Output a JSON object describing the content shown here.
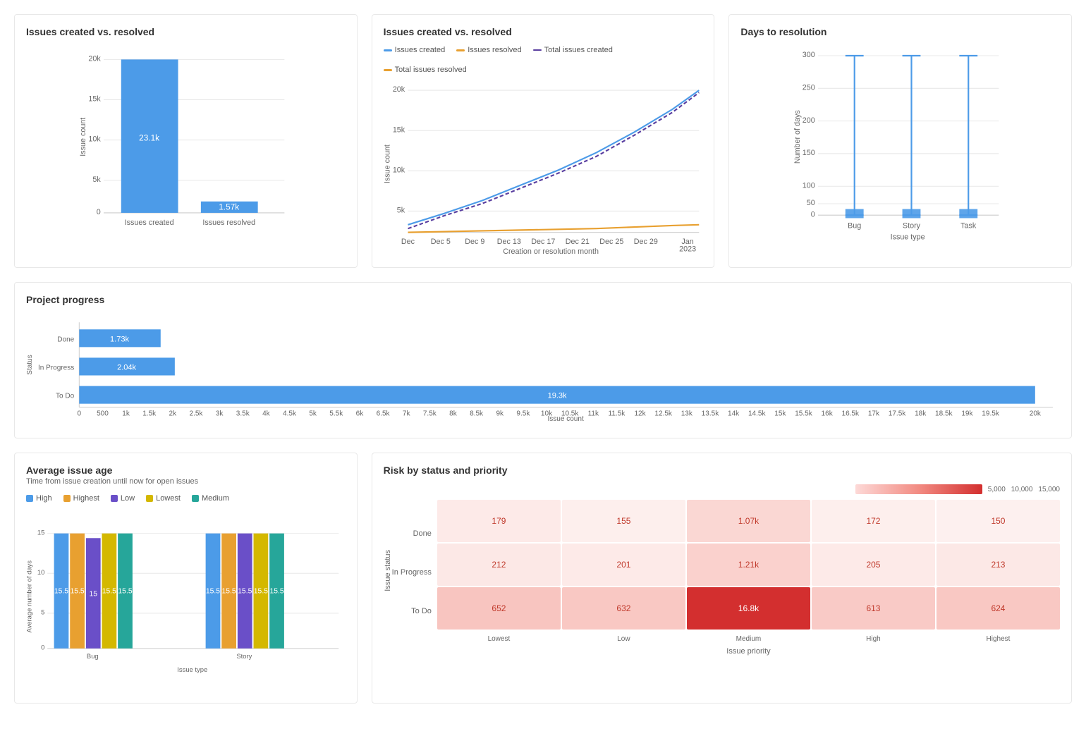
{
  "charts": {
    "bar_compare": {
      "title": "Issues created vs. resolved",
      "bars": [
        {
          "label": "Issues created",
          "value": "23.1k",
          "height_pct": 100
        },
        {
          "label": "Issues resolved",
          "value": "1.57k",
          "height_pct": 7
        }
      ],
      "y_labels": [
        "20k",
        "15k",
        "10k",
        "5k",
        "0"
      ],
      "y_axis_title": "Issue count"
    },
    "line_chart": {
      "title": "Issues created vs. resolved",
      "legend": [
        {
          "label": "Issues created",
          "color": "#4c9be8",
          "style": "solid"
        },
        {
          "label": "Issues resolved",
          "color": "#e8a030",
          "style": "solid"
        },
        {
          "label": "Total issues created",
          "color": "#5a3fa0",
          "style": "dashed"
        },
        {
          "label": "Total issues resolved",
          "color": "#e8a030",
          "style": "dashed"
        }
      ],
      "x_labels": [
        "Dec",
        "Dec 5",
        "Dec 9",
        "Dec 13",
        "Dec 17",
        "Dec 21",
        "Dec 25",
        "Dec 29",
        "Jan 2023"
      ],
      "y_labels": [
        "20k",
        "15k",
        "10k",
        "5k"
      ],
      "x_axis_title": "Creation or resolution month",
      "y_axis_title": "Issue count"
    },
    "days_resolution": {
      "title": "Days to resolution",
      "x_labels": [
        "Bug",
        "Story",
        "Task"
      ],
      "y_labels": [
        "300",
        "250",
        "200",
        "150",
        "100",
        "50",
        "0"
      ],
      "x_axis_title": "Issue type",
      "y_axis_title": "Number of days"
    },
    "project_progress": {
      "title": "Project progress",
      "bars": [
        {
          "label": "Done",
          "value": "1.73k",
          "width_pct": 8.65
        },
        {
          "label": "In Progress",
          "value": "2.04k",
          "width_pct": 10.2
        },
        {
          "label": "To Do",
          "value": "19.3k",
          "width_pct": 96.5
        }
      ],
      "x_labels": [
        "0",
        "500",
        "1k",
        "1.5k",
        "2k",
        "2.5k",
        "3k",
        "3.5k",
        "4k",
        "4.5k",
        "5k",
        "5.5k",
        "6k",
        "6.5k",
        "7k",
        "7.5k",
        "8k",
        "8.5k",
        "9k",
        "9.5k",
        "10k",
        "10.5k",
        "11k",
        "11.5k",
        "12k",
        "12.5k",
        "13k",
        "13.5k",
        "14k",
        "14.5k",
        "15k",
        "15.5k",
        "16k",
        "16.5k",
        "17k",
        "17.5k",
        "18k",
        "18.5k",
        "19k",
        "19.5k",
        "20k"
      ],
      "x_axis_title": "Issue count",
      "y_axis_title": "Status"
    },
    "issue_age": {
      "title": "Average issue age",
      "subtitle": "Time from issue creation until now for open issues",
      "legend": [
        {
          "label": "High",
          "color": "#4c9be8"
        },
        {
          "label": "Highest",
          "color": "#e8a030"
        },
        {
          "label": "Low",
          "color": "#6a4fc8"
        },
        {
          "label": "Lowest",
          "color": "#d4b800"
        },
        {
          "label": "Medium",
          "color": "#26a69a"
        }
      ],
      "groups": [
        {
          "label": "Bug",
          "bars": [
            {
              "priority": "High",
              "value": "15.5",
              "color": "#4c9be8"
            },
            {
              "priority": "Highest",
              "value": "15.5",
              "color": "#e8a030"
            },
            {
              "priority": "Low",
              "value": "15",
              "color": "#6a4fc8"
            },
            {
              "priority": "Lowest",
              "value": "15.5",
              "color": "#d4b800"
            },
            {
              "priority": "Medium",
              "value": "15.5",
              "color": "#26a69a"
            }
          ]
        },
        {
          "label": "Story",
          "bars": [
            {
              "priority": "High",
              "value": "15.5",
              "color": "#4c9be8"
            },
            {
              "priority": "Highest",
              "value": "15.5",
              "color": "#e8a030"
            },
            {
              "priority": "Low",
              "value": "15.5",
              "color": "#6a4fc8"
            },
            {
              "priority": "Lowest",
              "value": "15.5",
              "color": "#d4b800"
            },
            {
              "priority": "Medium",
              "value": "15.5",
              "color": "#26a69a"
            }
          ]
        }
      ],
      "y_labels": [
        "15",
        "10",
        "5",
        "0"
      ],
      "x_axis_title": "Issue type",
      "y_axis_title": "Average number of days"
    },
    "risk": {
      "title": "Risk by status and priority",
      "colorbar_labels": [
        "5,000",
        "10,000",
        "15,000"
      ],
      "row_labels": [
        "Done",
        "In Progress",
        "To Do"
      ],
      "col_labels": [
        "Lowest",
        "Low",
        "Medium",
        "High",
        "Highest"
      ],
      "cells": [
        [
          {
            "value": "179",
            "intensity": 0.05,
            "text_color": "#c0392b"
          },
          {
            "value": "155",
            "intensity": 0.04,
            "text_color": "#c0392b"
          },
          {
            "value": "1.07k",
            "intensity": 0.12,
            "text_color": "#c0392b"
          },
          {
            "value": "172",
            "intensity": 0.04,
            "text_color": "#c0392b"
          },
          {
            "value": "150",
            "intensity": 0.04,
            "text_color": "#c0392b"
          }
        ],
        [
          {
            "value": "212",
            "intensity": 0.06,
            "text_color": "#c0392b"
          },
          {
            "value": "201",
            "intensity": 0.05,
            "text_color": "#c0392b"
          },
          {
            "value": "1.21k",
            "intensity": 0.14,
            "text_color": "#c0392b"
          },
          {
            "value": "205",
            "intensity": 0.05,
            "text_color": "#c0392b"
          },
          {
            "value": "213",
            "intensity": 0.06,
            "text_color": "#c0392b"
          }
        ],
        [
          {
            "value": "652",
            "intensity": 0.2,
            "text_color": "#c0392b"
          },
          {
            "value": "632",
            "intensity": 0.19,
            "text_color": "#c0392b"
          },
          {
            "value": "16.8k",
            "intensity": 1.0,
            "text_color": "#fff"
          },
          {
            "value": "613",
            "intensity": 0.18,
            "text_color": "#c0392b"
          },
          {
            "value": "624",
            "intensity": 0.19,
            "text_color": "#c0392b"
          }
        ]
      ],
      "x_axis_title": "Issue priority",
      "y_axis_title": "Issue status"
    }
  }
}
